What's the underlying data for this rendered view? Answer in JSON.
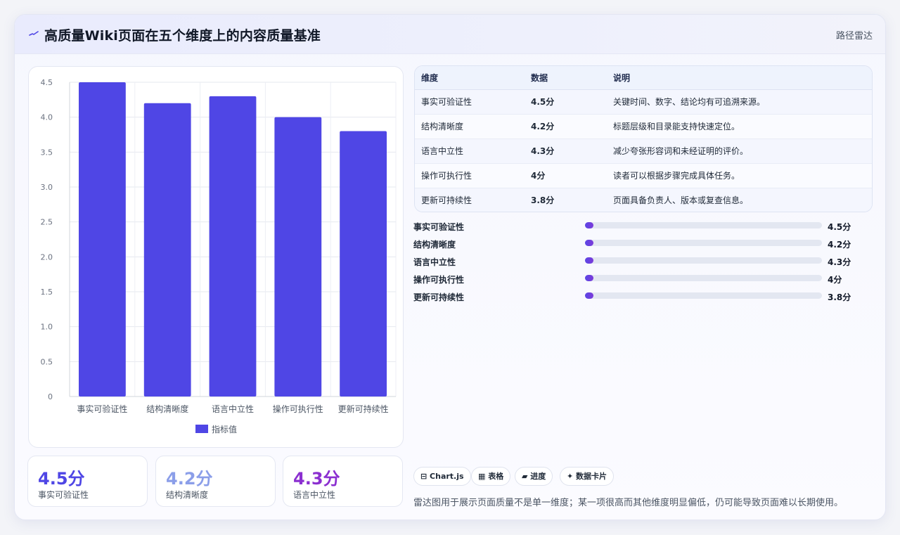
{
  "header": {
    "icon": "pulse-icon",
    "title": "高质量Wiki页面在五个维度上的内容质量基准",
    "route_label": "路径雷达"
  },
  "chart_data": {
    "type": "bar",
    "categories": [
      "事实可验证性",
      "结构清晰度",
      "语言中立性",
      "操作可执行性",
      "更新可持续性"
    ],
    "series": [
      {
        "name": "指标值",
        "values": [
          4.5,
          4.2,
          4.3,
          4.0,
          3.8
        ]
      }
    ],
    "ylim": [
      0,
      4.5
    ],
    "yticks": [
      "0",
      "0.5",
      "1.0",
      "1.5",
      "2.0",
      "2.5",
      "3.0",
      "3.5",
      "4.0",
      "4.5"
    ],
    "grid": true,
    "legend": "bottom",
    "bar_color": "#4f46e5"
  },
  "stats": [
    {
      "value": "4.5分",
      "label": "事实可验证性",
      "color": "#4f46e5"
    },
    {
      "value": "4.2分",
      "label": "结构清晰度",
      "color": "#8b9ee9"
    },
    {
      "value": "4.3分",
      "label": "语言中立性",
      "color": "#8b2fd0"
    }
  ],
  "table": {
    "headers": [
      "维度",
      "数据",
      "说明"
    ],
    "rows": [
      [
        "事实可验证性",
        "4.5分",
        "关键时间、数字、结论均有可追溯来源。"
      ],
      [
        "结构清晰度",
        "4.2分",
        "标题层级和目录能支持快速定位。"
      ],
      [
        "语言中立性",
        "4.3分",
        "减少夸张形容词和未经证明的评价。"
      ],
      [
        "操作可执行性",
        "4分",
        "读者可以根据步骤完成具体任务。"
      ],
      [
        "更新可持续性",
        "3.8分",
        "页面具备负责人、版本或复查信息。"
      ]
    ]
  },
  "progress": [
    {
      "label": "事实可验证性",
      "value": "4.5分",
      "fraction": 0.036
    },
    {
      "label": "结构清晰度",
      "value": "4.2分",
      "fraction": 0.036
    },
    {
      "label": "语言中立性",
      "value": "4.3分",
      "fraction": 0.036
    },
    {
      "label": "操作可执行性",
      "value": "4分",
      "fraction": 0.036
    },
    {
      "label": "更新可持续性",
      "value": "3.8分",
      "fraction": 0.036
    }
  ],
  "chips": [
    {
      "label": "⊟ Chart.js",
      "icon": "chart-icon"
    },
    {
      "label": "▦ 表格",
      "icon": "table-icon"
    },
    {
      "label": "▰ 进度",
      "icon": "progress-icon"
    },
    {
      "label": "✦ 数据卡片",
      "icon": "sparkle-icon"
    }
  ],
  "note": "雷达图用于展示页面质量不是单一维度；某一项很高而其他维度明显偏低，仍可能导致页面难以长期使用。"
}
